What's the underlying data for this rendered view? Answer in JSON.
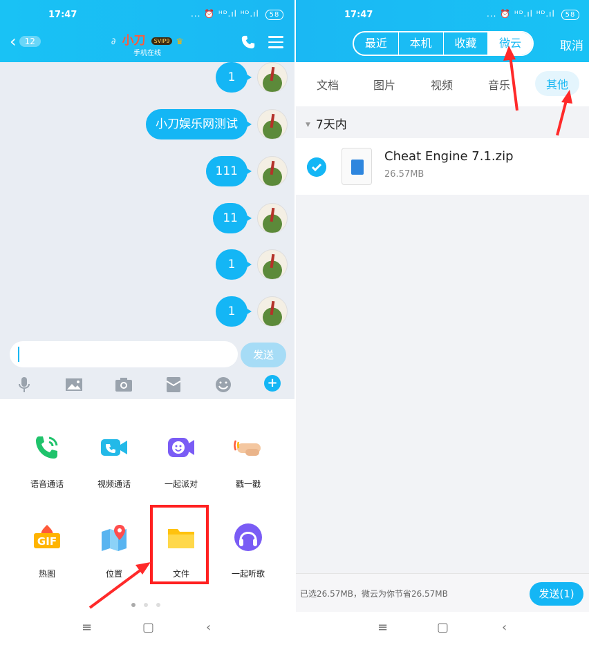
{
  "left": {
    "status": {
      "time": "17:47",
      "icons": "... ⏰ ᴴᴰ.ıl ᴴᴰ.ıl",
      "battery": "58"
    },
    "header": {
      "back_badge": "12",
      "contact_name": "小刀",
      "svip": "SVIP9",
      "subtitle": "手机在线"
    },
    "messages": [
      "1",
      "小刀娱乐网测试",
      "111",
      "11",
      "1",
      "1"
    ],
    "send_label": "发送",
    "features": [
      "语音通话",
      "视频通话",
      "一起派对",
      "戳一戳",
      "热图",
      "位置",
      "文件",
      "一起听歌"
    ],
    "gif_label": "GIF"
  },
  "right": {
    "status": {
      "time": "17:47",
      "icons": "... ⏰ ᴴᴰ.ıl ᴴᴰ.ıl",
      "battery": "58"
    },
    "segments": [
      "最近",
      "本机",
      "收藏",
      "微云"
    ],
    "active_segment": "微云",
    "cancel_label": "取消",
    "categories": [
      "文档",
      "图片",
      "视频",
      "音乐",
      "其他"
    ],
    "active_category": "其他",
    "group_title": "7天内",
    "file": {
      "name": "Cheat Engine 7.1.zip",
      "size": "26.57MB"
    },
    "bottom_info": "已选26.57MB，微云为你节省26.57MB",
    "send_label": "发送(1)"
  },
  "colors": {
    "accent": "#1ab8f3",
    "bubble": "#14b6f5",
    "highlight": "#ff2020"
  }
}
